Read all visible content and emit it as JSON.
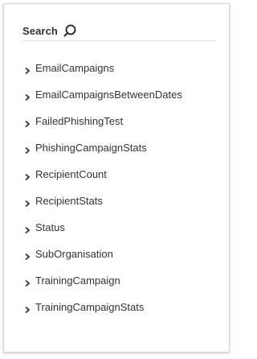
{
  "search": {
    "label": "Search",
    "icon": "search-icon"
  },
  "nav": {
    "items": [
      {
        "label": "EmailCampaigns",
        "icon": "chevron-right-icon"
      },
      {
        "label": "EmailCampaignsBetweenDates",
        "icon": "chevron-right-icon"
      },
      {
        "label": "FailedPhishingTest",
        "icon": "chevron-right-icon"
      },
      {
        "label": "PhishingCampaignStats",
        "icon": "chevron-right-icon"
      },
      {
        "label": "RecipientCount",
        "icon": "chevron-right-icon"
      },
      {
        "label": "RecipientStats",
        "icon": "chevron-right-icon"
      },
      {
        "label": "Status",
        "icon": "chevron-right-icon"
      },
      {
        "label": "SubOrganisation",
        "icon": "chevron-right-icon"
      },
      {
        "label": "TrainingCampaign",
        "icon": "chevron-right-icon"
      },
      {
        "label": "TrainingCampaignStats",
        "icon": "chevron-right-icon"
      }
    ]
  },
  "colors": {
    "text": "#333333",
    "border": "#d6d6d6",
    "divider": "#e6e6e6"
  }
}
